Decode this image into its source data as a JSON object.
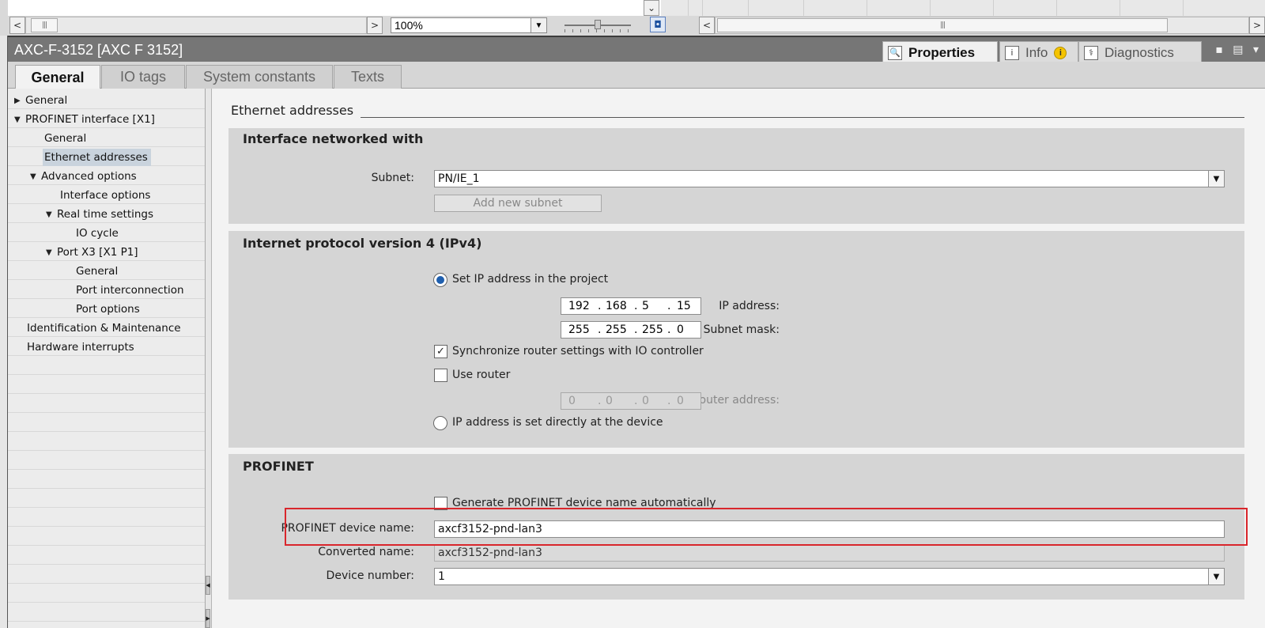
{
  "toolbar": {
    "zoom_value": "100%",
    "zoom_level": 0.5
  },
  "window": {
    "title": "AXC-F-3152 [AXC F 3152]",
    "tabs": [
      {
        "label": "Properties",
        "active": true,
        "icon": "properties-icon"
      },
      {
        "label": "Info",
        "active": false,
        "icon": "info-icon"
      },
      {
        "label": "Diagnostics",
        "active": false,
        "icon": "diagnostics-icon"
      }
    ]
  },
  "subtabs": [
    "General",
    "IO tags",
    "System constants",
    "Texts"
  ],
  "nav": {
    "items": [
      {
        "label": "General",
        "caret": "▶"
      },
      {
        "label": "PROFINET interface [X1]",
        "caret": "▼"
      },
      {
        "label": "General",
        "caret": ""
      },
      {
        "label": "Ethernet addresses",
        "caret": "",
        "selected": true
      },
      {
        "label": "Advanced options",
        "caret": "▼"
      },
      {
        "label": "Interface options",
        "caret": ""
      },
      {
        "label": "Real time settings",
        "caret": "▼"
      },
      {
        "label": "IO cycle",
        "caret": ""
      },
      {
        "label": "Port X3 [X1 P1]",
        "caret": "▼"
      },
      {
        "label": "General",
        "caret": ""
      },
      {
        "label": "Port interconnection",
        "caret": ""
      },
      {
        "label": "Port options",
        "caret": ""
      },
      {
        "label": "Identification & Maintenance",
        "caret": ""
      },
      {
        "label": "Hardware interrupts",
        "caret": ""
      }
    ]
  },
  "content": {
    "section_title": "Ethernet addresses",
    "networked": {
      "title": "Interface networked with",
      "subnet_label": "Subnet:",
      "subnet_value": "PN/IE_1",
      "add_subnet": "Add new subnet"
    },
    "ipv4": {
      "title": "Internet protocol version 4 (IPv4)",
      "set_in_project": "Set IP address in the project",
      "ip_label": "IP address:",
      "ip": [
        "192",
        "168",
        "5",
        "15"
      ],
      "mask_label": "Subnet mask:",
      "mask": [
        "255",
        "255",
        "255",
        "0"
      ],
      "sync_router": "Synchronize router settings with IO controller",
      "use_router": "Use router",
      "router_label": "Router address:",
      "router": [
        "0",
        "0",
        "0",
        "0"
      ],
      "set_at_device": "IP address is set directly at the device",
      "dot": "."
    },
    "profinet": {
      "title": "PROFINET",
      "auto_name": "Generate PROFINET device name automatically",
      "device_name_label": "PROFINET device name:",
      "device_name_value": "axcf3152-pnd-lan3",
      "converted_label": "Converted name:",
      "converted_value": "axcf3152-pnd-lan3",
      "device_number_label": "Device number:",
      "device_number_value": "1"
    }
  },
  "colors": {
    "highlight": "#d9262c",
    "radio_accent": "#1f5fae",
    "title_bar": "#767676"
  }
}
